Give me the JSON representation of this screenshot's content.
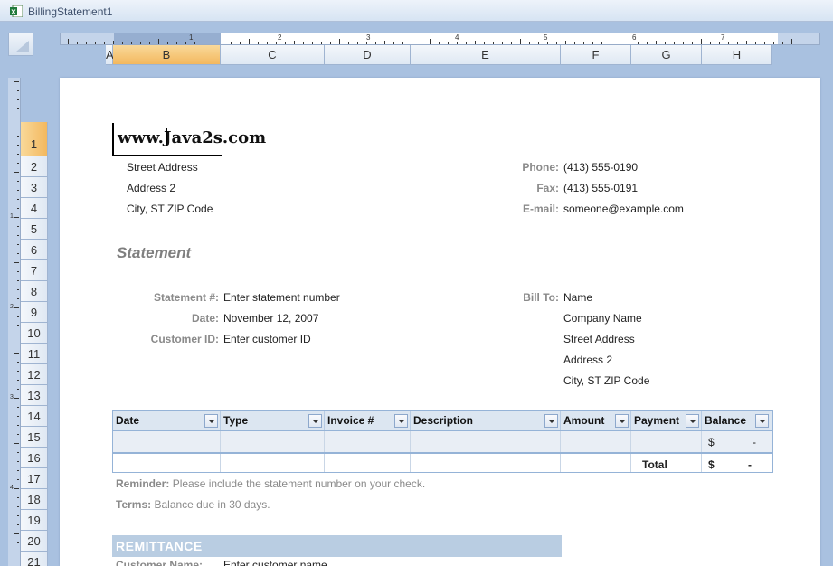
{
  "window": {
    "title": "BillingStatement1",
    "app_icon": "excel-icon"
  },
  "ruler": {
    "h_numbers": [
      "1",
      "2",
      "3",
      "4",
      "5",
      "6",
      "7"
    ],
    "v_numbers": [
      "1",
      "2",
      "3",
      "4"
    ]
  },
  "columns": [
    "A",
    "B",
    "C",
    "D",
    "E",
    "F",
    "G",
    "H"
  ],
  "selected_column": "B",
  "rows": [
    "1",
    "2",
    "3",
    "4",
    "5",
    "6",
    "7",
    "8",
    "9",
    "10",
    "11",
    "12",
    "13",
    "14",
    "15",
    "16",
    "17",
    "18",
    "19",
    "20",
    "21"
  ],
  "selected_row": "1",
  "company": {
    "website": "www.Java2s.com",
    "street": "Street Address",
    "address2": "Address 2",
    "city": "City, ST  ZIP Code"
  },
  "contact": {
    "phone_label": "Phone:",
    "phone": "(413) 555-0190",
    "fax_label": "Fax:",
    "fax": "(413) 555-0191",
    "email_label": "E-mail:",
    "email": "someone@example.com"
  },
  "statement_heading": "Statement",
  "statement_info": {
    "number_label": "Statement #:",
    "number": "Enter statement number",
    "date_label": "Date:",
    "date": "November 12, 2007",
    "customer_label": "Customer ID:",
    "customer": "Enter customer ID"
  },
  "bill_to": {
    "label": "Bill To:",
    "name": "Name",
    "company": "Company Name",
    "street": "Street Address",
    "address2": "Address 2",
    "city": "City, ST  ZIP Code"
  },
  "table": {
    "headers": [
      "Date",
      "Type",
      "Invoice #",
      "Description",
      "Amount",
      "Payment",
      "Balance"
    ],
    "row_balance_currency": "$",
    "row_balance_value": "-",
    "total_label": "Total",
    "total_currency": "$",
    "total_value": "-"
  },
  "reminder": {
    "label": "Reminder:",
    "text": "Please include the statement number on your check."
  },
  "terms": {
    "label": "Terms:",
    "text": "Balance due in 30 days."
  },
  "remittance": {
    "title": "REMITTANCE",
    "customer_name_label": "Customer Name:",
    "customer_name_value": "Enter customer name"
  }
}
